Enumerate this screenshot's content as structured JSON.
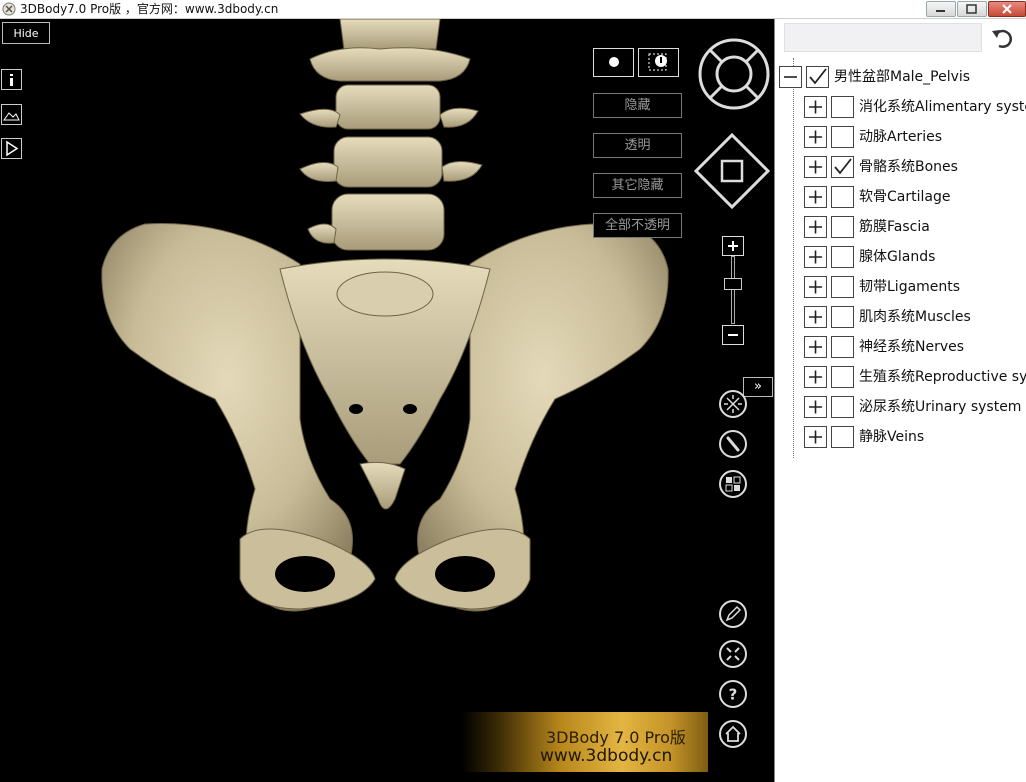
{
  "window": {
    "title": "3DBody7.0 Pro版 ，官方网：www.3dbody.cn"
  },
  "viewport": {
    "hide_label": "Hide",
    "left_tools": [
      {
        "name": "info-icon"
      },
      {
        "name": "image-icon"
      },
      {
        "name": "play-icon"
      }
    ],
    "view_mode_buttons": [
      {
        "name": "solid-view-icon"
      },
      {
        "name": "partial-view-icon"
      }
    ],
    "option_buttons": [
      {
        "label": "隐藏"
      },
      {
        "label": "透明"
      },
      {
        "label": "其它隐藏"
      },
      {
        "label": "全部不透明"
      }
    ],
    "expand_label": "»",
    "watermark": {
      "line1": "3DBody 7.0 Pro版",
      "line2": "www.3dbody.cn"
    },
    "icons": {
      "rotate": "rotate-ring-icon",
      "pan": "pan-diamond-icon",
      "zoom_in": "zoom-in-icon",
      "zoom_out": "zoom-out-icon",
      "explode": "explode-icon",
      "scalpel": "scalpel-icon",
      "layout": "layout-grid-icon",
      "pen": "pen-icon",
      "fit": "fit-view-icon",
      "help": "help-icon",
      "home": "home-icon"
    }
  },
  "tree": {
    "root": {
      "label": "男性盆部Male_Pelvis",
      "checked": true,
      "expanded": true
    },
    "children": [
      {
        "label": "消化系统Alimentary syste",
        "checked": false
      },
      {
        "label": "动脉Arteries",
        "checked": false
      },
      {
        "label": "骨骼系统Bones",
        "checked": true
      },
      {
        "label": "软骨Cartilage",
        "checked": false
      },
      {
        "label": "筋膜Fascia",
        "checked": false
      },
      {
        "label": "腺体Glands",
        "checked": false
      },
      {
        "label": "韧带Ligaments",
        "checked": false
      },
      {
        "label": "肌肉系统Muscles",
        "checked": false
      },
      {
        "label": "神经系统Nerves",
        "checked": false
      },
      {
        "label": "生殖系统Reproductive sys",
        "checked": false
      },
      {
        "label": "泌尿系统Urinary system",
        "checked": false
      },
      {
        "label": "静脉Veins",
        "checked": false
      }
    ]
  },
  "colors": {
    "bone": "#d8ccaa",
    "bone_shade": "#9c9070",
    "accent_gold": "#e3b542"
  }
}
